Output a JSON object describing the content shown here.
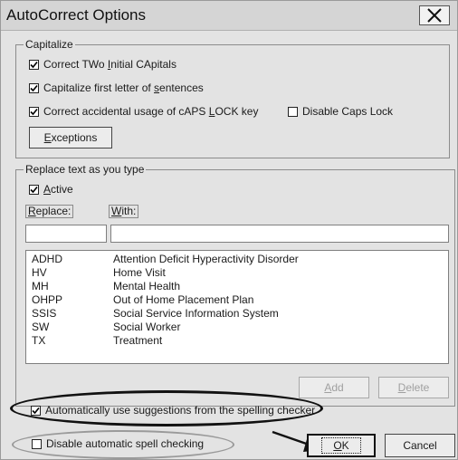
{
  "window": {
    "title": "AutoCorrect Options",
    "close_glyph": "✕"
  },
  "capitalize": {
    "legend": "Capitalize",
    "options": [
      {
        "pre": "Correct TWo ",
        "mn": "I",
        "post": "nitial CApitals",
        "checked": true
      },
      {
        "pre": "Capitalize first letter of ",
        "mn": "s",
        "post": "entences",
        "checked": true
      },
      {
        "pre": "Correct accidental usage of cAPS ",
        "mn": "L",
        "post": "OCK key",
        "checked": true
      }
    ],
    "disable_caps": {
      "label": "Disable Caps Lock",
      "checked": false
    },
    "exceptions_button": {
      "mn": "E",
      "post": "xceptions"
    }
  },
  "replace": {
    "legend": "Replace text as you type",
    "active": {
      "mn": "A",
      "post": "ctive",
      "checked": true
    },
    "replace_label": {
      "mn": "R",
      "post": "eplace:"
    },
    "with_label": {
      "mn": "W",
      "post": "ith:"
    },
    "replace_value": "",
    "with_value": "",
    "entries": [
      {
        "abbr": "ADHD",
        "full": "Attention Deficit Hyperactivity Disorder"
      },
      {
        "abbr": "HV",
        "full": "Home Visit"
      },
      {
        "abbr": "MH",
        "full": "Mental Health"
      },
      {
        "abbr": "OHPP",
        "full": "Out of Home Placement Plan"
      },
      {
        "abbr": "SSIS",
        "full": "Social Service Information System"
      },
      {
        "abbr": "SW",
        "full": "Social Worker"
      },
      {
        "abbr": "TX",
        "full": "Treatment"
      }
    ],
    "add_button": {
      "mn": "A",
      "post": "dd"
    },
    "delete_button": {
      "mn": "D",
      "post": "elete"
    },
    "auto_suggest": {
      "label": "Automatically use suggestions from the spelling checker",
      "checked": true
    }
  },
  "footer": {
    "disable_spell": {
      "label": "Disable automatic spell checking",
      "checked": false
    },
    "ok_button": {
      "mn": "O",
      "post": "K"
    },
    "cancel_button": {
      "label": "Cancel"
    }
  },
  "colors": {
    "dialog_bg": "#e3e3e3",
    "highlight_ellipse_dark": "#111111",
    "highlight_ellipse_light": "#9a9a9a"
  }
}
